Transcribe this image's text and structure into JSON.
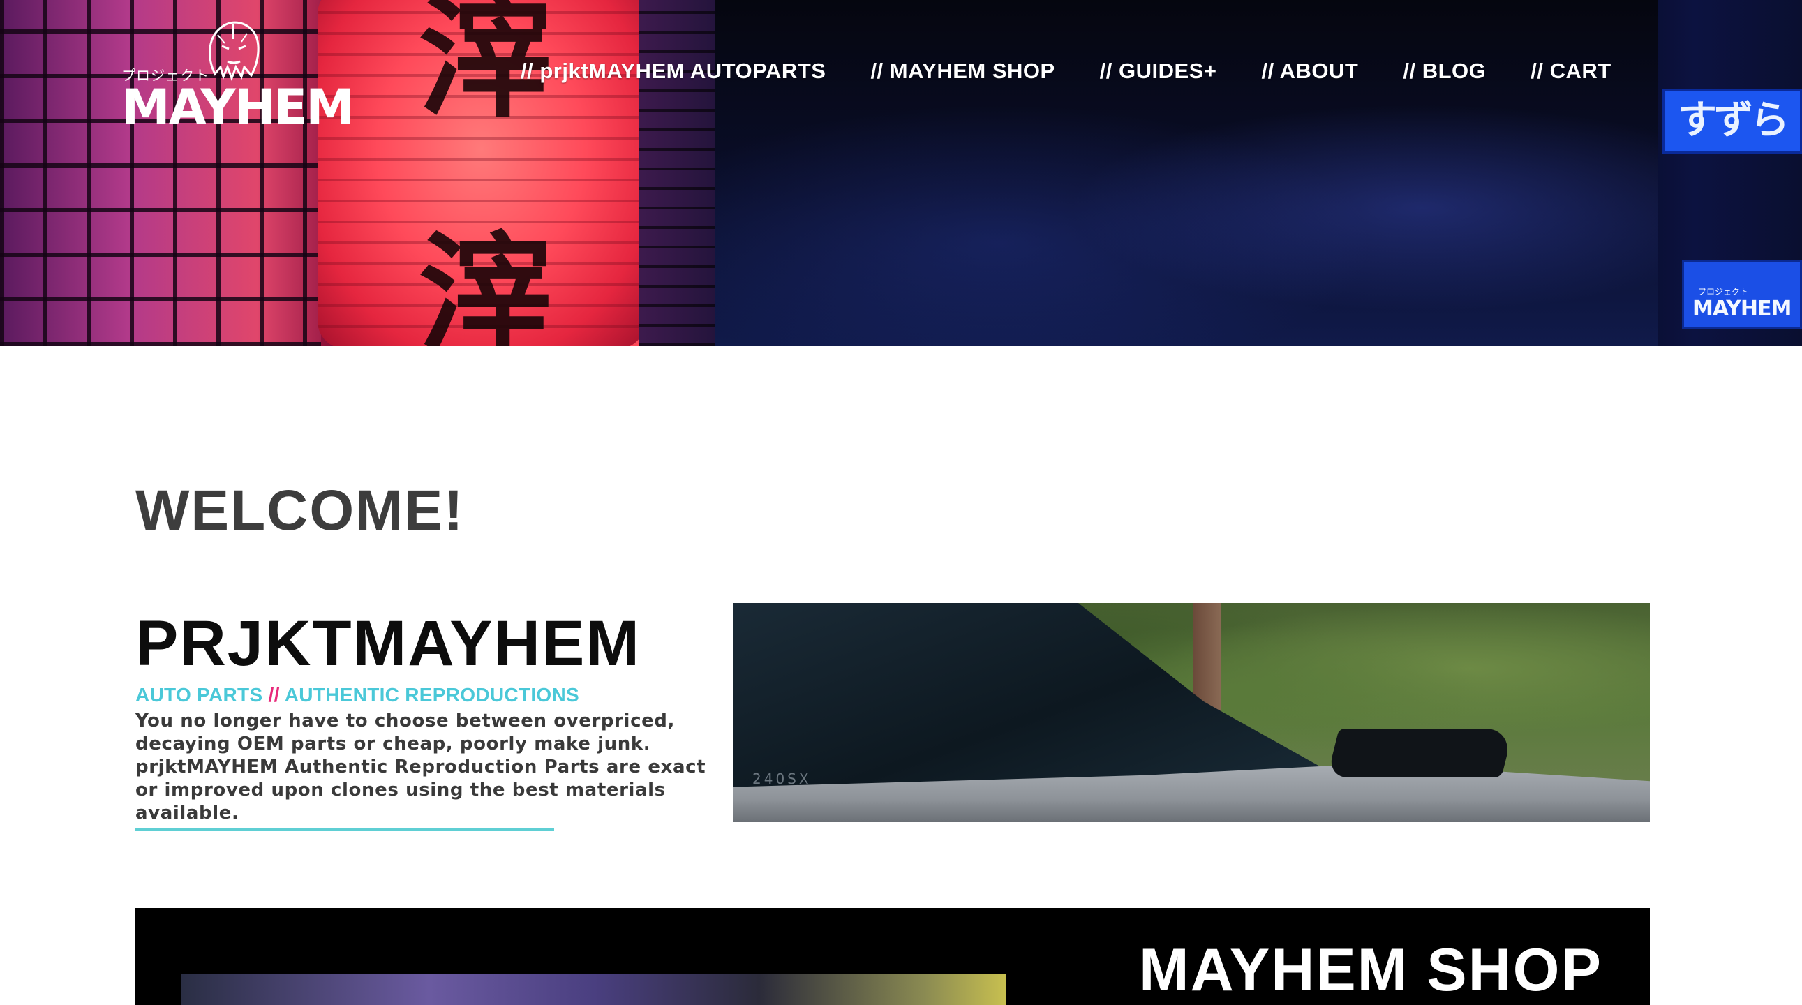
{
  "header": {
    "logo": {
      "kana": "プロジェクト",
      "wordmark": "MAYHEM"
    },
    "nav": [
      {
        "label": "// prjktMAYHEM AUTOPARTS"
      },
      {
        "label": "// MAYHEM SHOP"
      },
      {
        "label": "// GUIDES+"
      },
      {
        "label": "// ABOUT"
      },
      {
        "label": "// BLOG"
      },
      {
        "label": "// CART"
      }
    ],
    "background_signs": {
      "kanji_top": "滓",
      "kanji_bottom": "滓",
      "sign_top_text": "すずらん",
      "sign_bottom_small": "プロジェクト",
      "sign_bottom_big": "MAYHEM"
    }
  },
  "welcome": {
    "heading": "WELCOME!",
    "brand_title": "PRJKTMAYHEM",
    "tagline_left": "AUTO PARTS",
    "tagline_sep": "//",
    "tagline_right": "AUTHENTIC REPRODUCTIONS",
    "description": "You no longer have to choose between overpriced, decaying OEM parts or cheap, poorly make junk. prjktMAYHEM Authentic Reproduction Parts are exact or improved upon clones using the best materials available.",
    "car_badge": "240SX"
  },
  "shop": {
    "title": "MAYHEM SHOP"
  },
  "colors": {
    "accent_teal": "#4ac8d8",
    "accent_pink": "#e8297a",
    "rule_teal": "#5fcfd4",
    "heading_gray": "#3d3d3d",
    "banner_black": "#000000"
  }
}
